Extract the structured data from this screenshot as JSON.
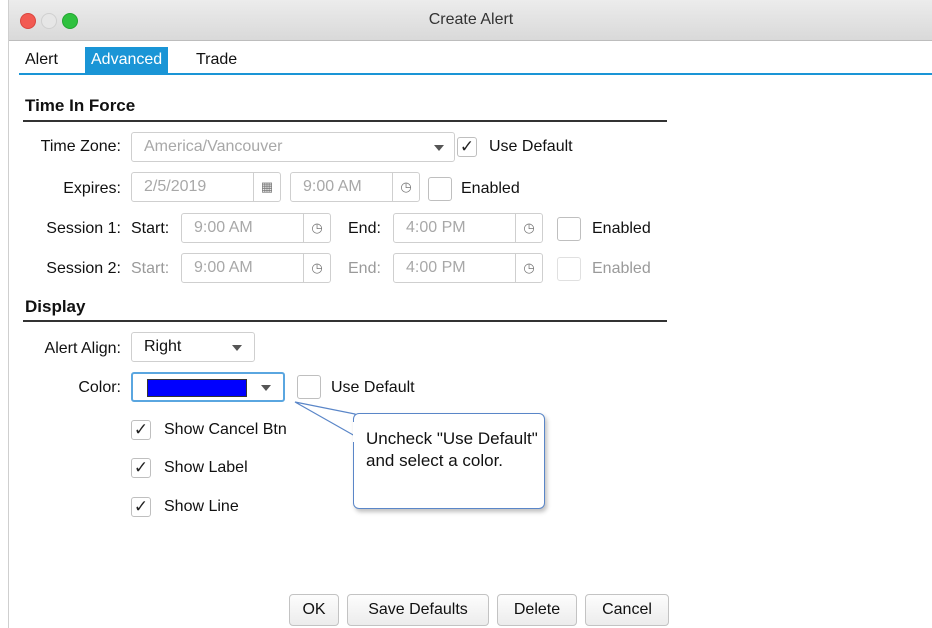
{
  "window": {
    "title": "Create Alert"
  },
  "tabs": [
    "Alert",
    "Advanced",
    "Trade"
  ],
  "time_in_force": {
    "heading": "Time In Force",
    "time_zone": {
      "label": "Time Zone:",
      "value": "America/Vancouver",
      "use_default_label": "Use Default",
      "use_default_checked": true
    },
    "expires": {
      "label": "Expires:",
      "date": "2/5/2019",
      "time": "9:00 AM",
      "enabled_label": "Enabled",
      "enabled_checked": false
    },
    "session1": {
      "label": "Session 1:",
      "start_label": "Start:",
      "start_time": "9:00 AM",
      "end_label": "End:",
      "end_time": "4:00 PM",
      "enabled_label": "Enabled"
    },
    "session2": {
      "label": "Session 2:",
      "start_label": "Start:",
      "start_time": "9:00 AM",
      "end_label": "End:",
      "end_time": "4:00 PM",
      "enabled_label": "Enabled"
    }
  },
  "display": {
    "heading": "Display",
    "alert_align": {
      "label": "Alert Align:",
      "value": "Right"
    },
    "color": {
      "label": "Color:",
      "swatch": "#0000ff",
      "use_default_label": "Use Default",
      "use_default_checked": false
    },
    "show_cancel_btn": {
      "label": "Show Cancel Btn",
      "checked": true
    },
    "show_label": {
      "label": "Show Label",
      "checked": true
    },
    "show_line": {
      "label": "Show Line",
      "checked": true
    }
  },
  "callout": {
    "text": "Uncheck \"Use Default\" and select a color."
  },
  "buttons": {
    "ok": "OK",
    "save_defaults": "Save Defaults",
    "delete": "Delete",
    "cancel": "Cancel"
  },
  "colors": {
    "accent": "#1a95d6",
    "callout_border": "#5a86c8"
  }
}
